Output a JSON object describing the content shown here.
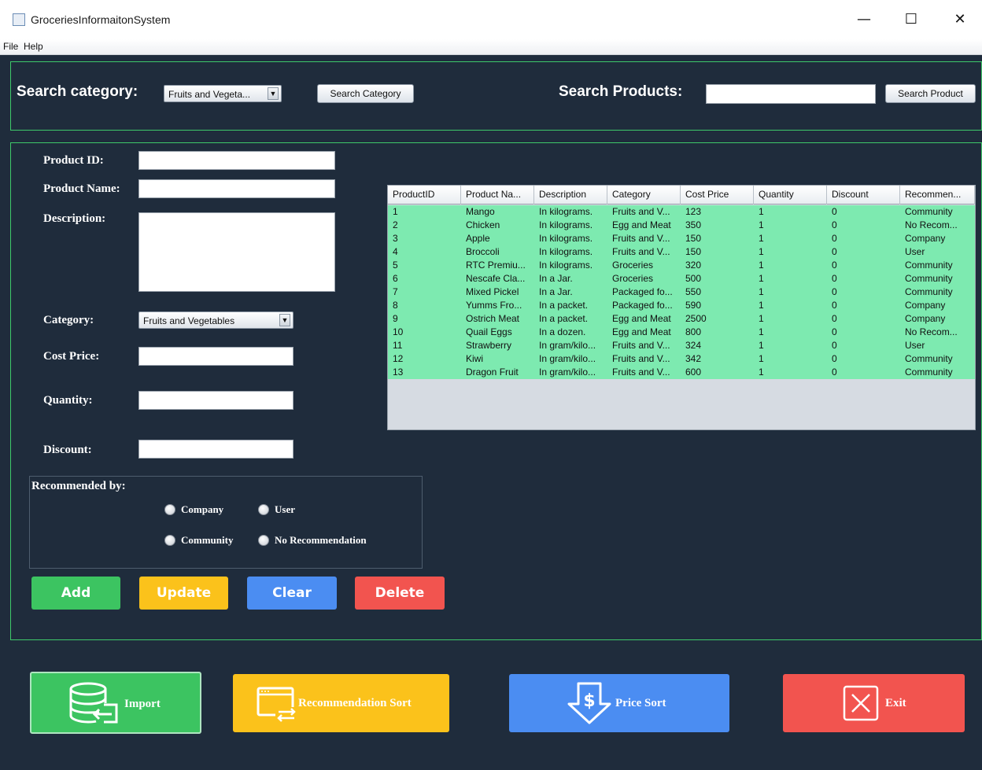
{
  "window": {
    "title": "GroceriesInformaitonSystem",
    "minimize": "—",
    "maximize": "☐",
    "close": "✕"
  },
  "menu": {
    "file": "File",
    "help": "Help"
  },
  "search": {
    "category_label": "Search category:",
    "category_value": "Fruits and Vegeta...",
    "category_button": "Search Category",
    "products_label": "Search Products:",
    "products_value": "",
    "products_button": "Search Product"
  },
  "form": {
    "product_id_label": "Product ID:",
    "product_id_value": "",
    "product_name_label": "Product Name:",
    "product_name_value": "",
    "description_label": "Description:",
    "description_value": "",
    "category_label": "Category:",
    "category_value": "Fruits and Vegetables",
    "cost_price_label": "Cost Price:",
    "cost_price_value": "",
    "quantity_label": "Quantity:",
    "quantity_value": "",
    "discount_label": "Discount:",
    "discount_value": "",
    "recommended_label": "Recommended by:",
    "radio_company": "Company",
    "radio_user": "User",
    "radio_community": "Community",
    "radio_none": "No Recommendation"
  },
  "actions": {
    "add": "Add",
    "update": "Update",
    "clear": "Clear",
    "delete": "Delete"
  },
  "bottom": {
    "import": "Import",
    "recommendation_sort": "Recommendation Sort",
    "price_sort": "Price Sort",
    "exit": "Exit"
  },
  "table": {
    "columns": [
      "ProductID",
      "Product Na...",
      "Description",
      "Category",
      "Cost Price",
      "Quantity",
      "Discount",
      "Recommen..."
    ],
    "rows": [
      [
        "1",
        "Mango",
        "In kilograms.",
        "Fruits and V...",
        "123",
        "1",
        "0",
        "Community"
      ],
      [
        "2",
        "Chicken",
        "In kilograms.",
        "Egg and Meat",
        "350",
        "1",
        "0",
        "No Recom..."
      ],
      [
        "3",
        "Apple",
        "In kilograms.",
        "Fruits and V...",
        "150",
        "1",
        "0",
        "Company"
      ],
      [
        "4",
        "Broccoli",
        "In kilograms.",
        "Fruits and V...",
        "150",
        "1",
        "0",
        "User"
      ],
      [
        "5",
        "RTC Premiu...",
        "In kilograms.",
        "Groceries",
        "320",
        "1",
        "0",
        "Community"
      ],
      [
        "6",
        "Nescafe Cla...",
        "In a Jar.",
        "Groceries",
        "500",
        "1",
        "0",
        "Community"
      ],
      [
        "7",
        "Mixed Pickel",
        "In a Jar.",
        "Packaged fo...",
        "550",
        "1",
        "0",
        "Community"
      ],
      [
        "8",
        "Yumms Fro...",
        "In a packet.",
        "Packaged fo...",
        "590",
        "1",
        "0",
        "Company"
      ],
      [
        "9",
        "Ostrich Meat",
        "In a packet.",
        "Egg and Meat",
        "2500",
        "1",
        "0",
        "Company"
      ],
      [
        "10",
        "Quail Eggs",
        "In a dozen.",
        "Egg and Meat",
        "800",
        "1",
        "0",
        "No Recom..."
      ],
      [
        "11",
        "Strawberry",
        "In gram/kilo...",
        "Fruits and V...",
        "324",
        "1",
        "0",
        "User"
      ],
      [
        "12",
        "Kiwi",
        "In gram/kilo...",
        "Fruits and V...",
        "342",
        "1",
        "0",
        "Community"
      ],
      [
        "13",
        "Dragon Fruit",
        "In gram/kilo...",
        "Fruits and V...",
        "600",
        "1",
        "0",
        "Community"
      ]
    ]
  },
  "colors": {
    "background": "#1f2c3c",
    "border_green": "#3ec96a",
    "table_rows": "#7deab0",
    "add": "#3cc461",
    "update": "#fbc21b",
    "clear": "#4b8df2",
    "delete": "#f2544f"
  }
}
